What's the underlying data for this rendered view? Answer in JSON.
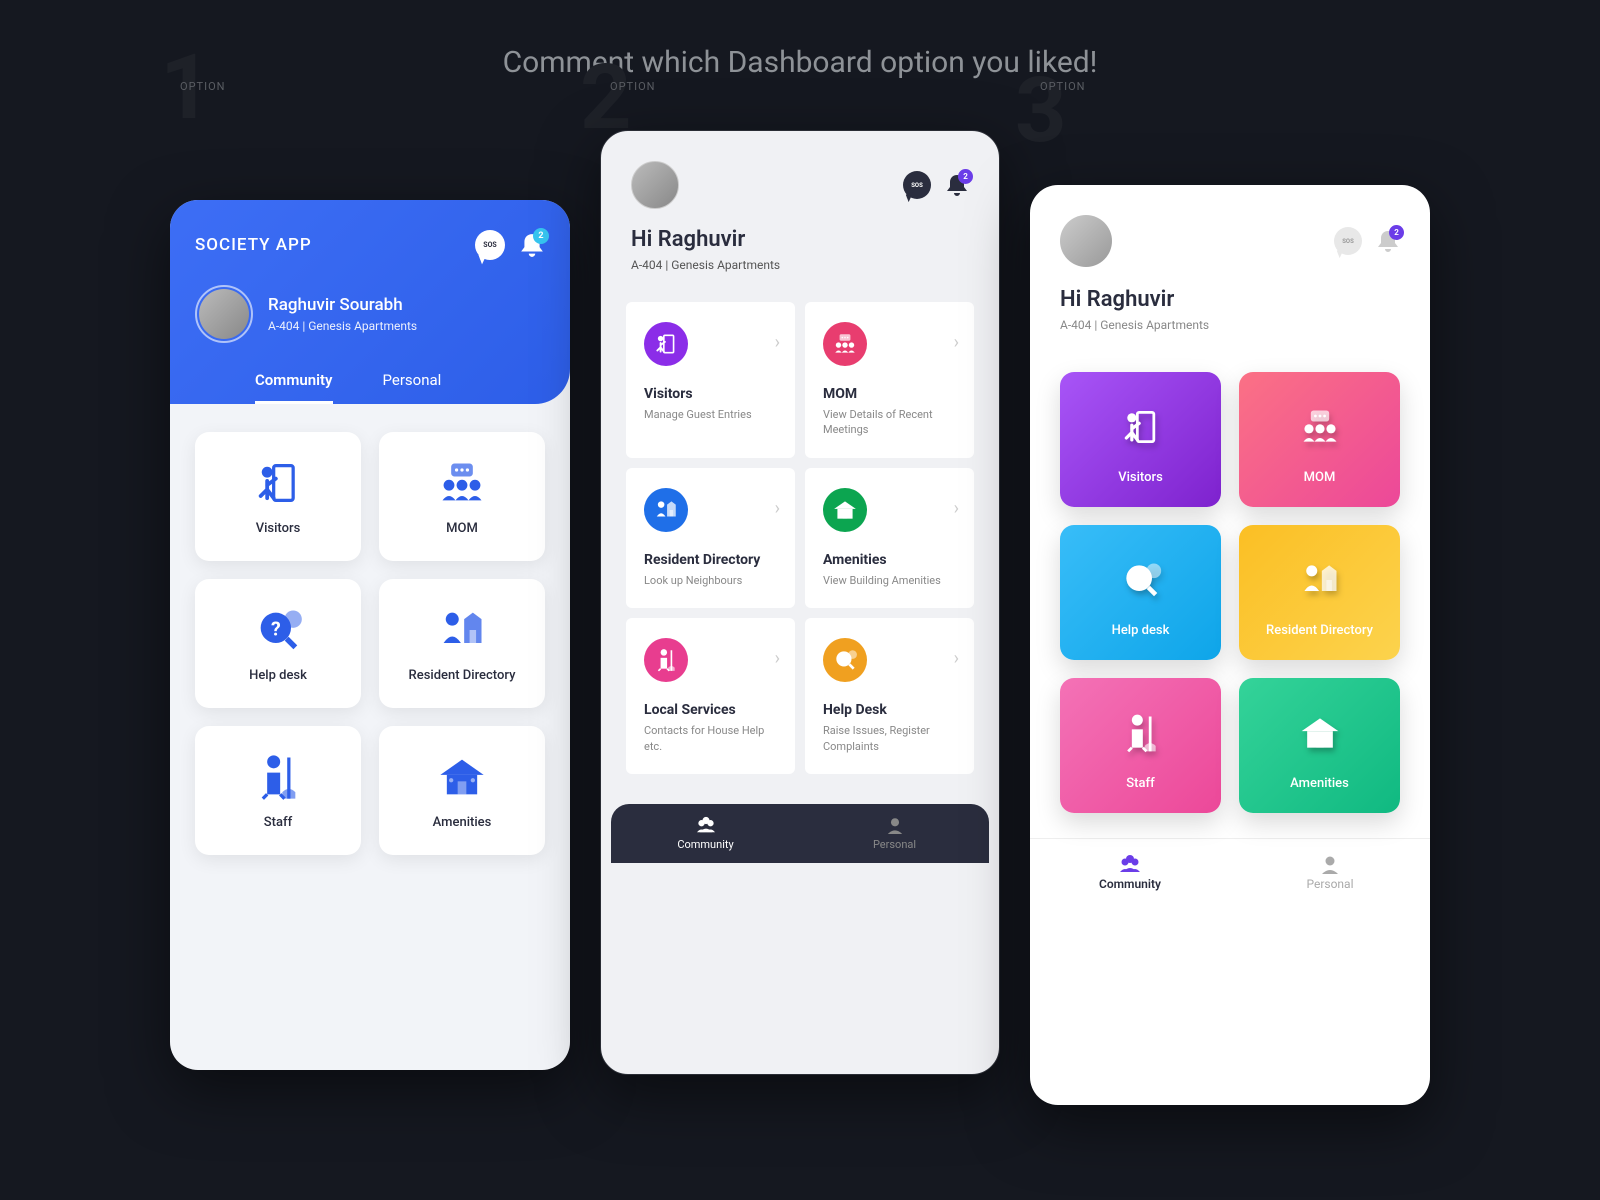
{
  "page_title": "Comment which Dashboard option you liked!",
  "option_label": "OPTION",
  "badge_count": "2",
  "sos": "SOS",
  "option1": {
    "app_title": "SOCIETY APP",
    "user_name": "Raghuvir Sourabh",
    "user_sub": "A-404 | Genesis Apartments",
    "tabs": {
      "community": "Community",
      "personal": "Personal"
    },
    "cards": [
      "Visitors",
      "MOM",
      "Help desk",
      "Resident Directory",
      "Staff",
      "Amenities"
    ]
  },
  "option2": {
    "greeting": "Hi Raghuvir",
    "sub": "A-404 | Genesis Apartments",
    "cards": [
      {
        "title": "Visitors",
        "sub": "Manage Guest Entries"
      },
      {
        "title": "MOM",
        "sub": "View Details of Recent Meetings"
      },
      {
        "title": "Resident Directory",
        "sub": "Look up Neighbours"
      },
      {
        "title": "Amenities",
        "sub": "View Building Amenities"
      },
      {
        "title": "Local Services",
        "sub": "Contacts for House Help etc."
      },
      {
        "title": "Help Desk",
        "sub": "Raise Issues, Register Complaints"
      }
    ],
    "nav": {
      "community": "Community",
      "personal": "Personal"
    }
  },
  "option3": {
    "greeting": "Hi Raghuvir",
    "sub": "A-404 | Genesis Apartments",
    "cards": [
      "Visitors",
      "MOM",
      "Help desk",
      "Resident Directory",
      "Staff",
      "Amenities"
    ],
    "nav": {
      "community": "Community",
      "personal": "Personal"
    }
  }
}
